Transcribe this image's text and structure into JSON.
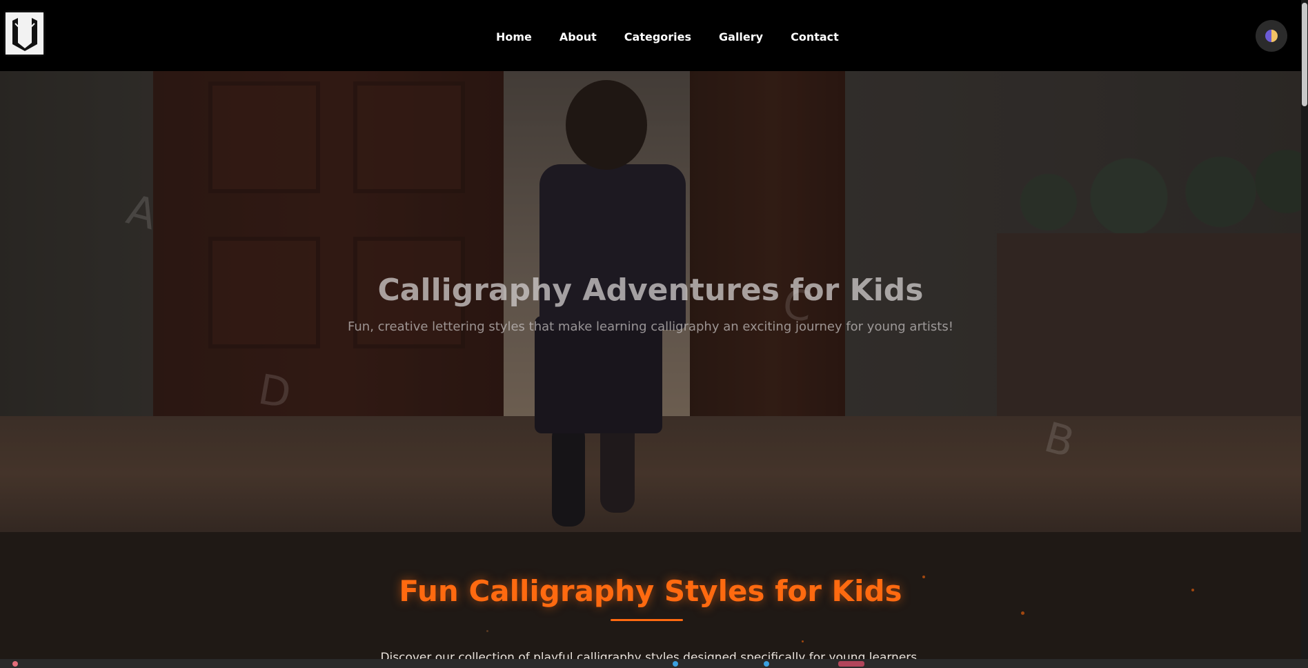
{
  "nav": {
    "logo_alt": "Calligraphy logo",
    "links": [
      {
        "label": "Home"
      },
      {
        "label": "About"
      },
      {
        "label": "Categories"
      },
      {
        "label": "Gallery"
      },
      {
        "label": "Contact"
      }
    ],
    "theme_toggle_icon": "half-moon-icon"
  },
  "hero": {
    "title": "Calligraphy Adventures for Kids",
    "subtitle": "Fun, creative lettering styles that make learning calligraphy an exciting journey for young artists!",
    "floating_letters": [
      "A",
      "B",
      "C",
      "D"
    ]
  },
  "styles_section": {
    "title": "Fun Calligraphy Styles for Kids",
    "description": "Discover our collection of playful calligraphy styles designed specifically for young learners."
  },
  "colors": {
    "accent": "#ff6a10",
    "nav_bg": "#000000",
    "section_bg": "#1f1915"
  }
}
